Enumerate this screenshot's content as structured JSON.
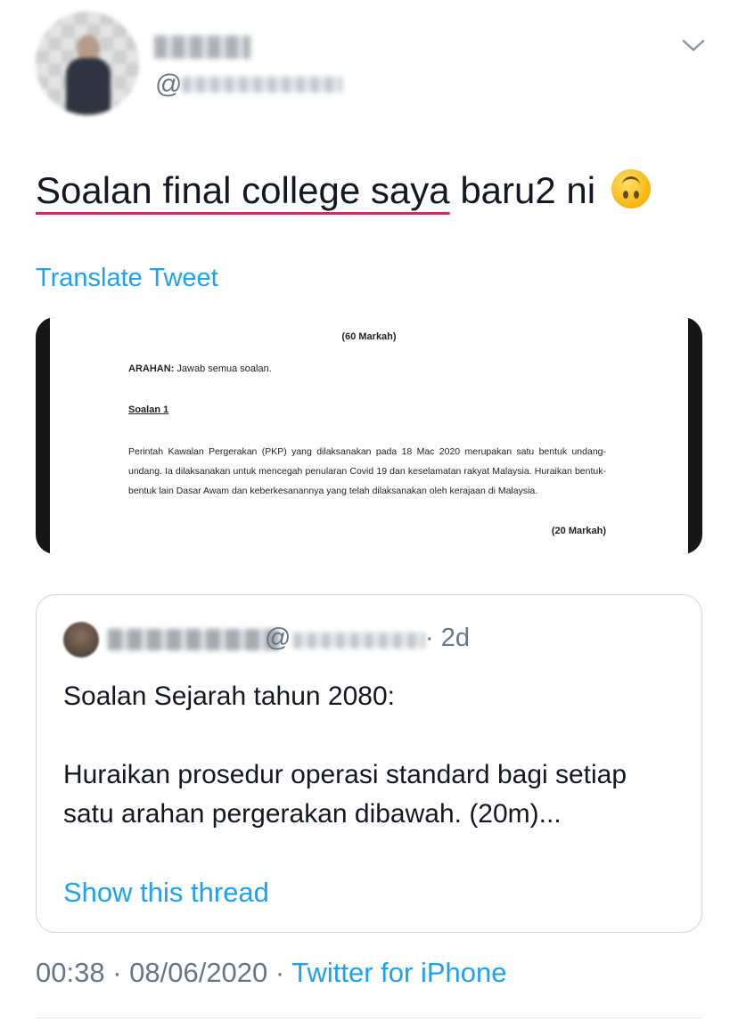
{
  "tweet": {
    "handle_prefix": "@",
    "text_underlined": "Soalan final college saya",
    "text_rest": " baru2 ni",
    "emoji": "upside-down-face",
    "translate_label": "Translate Tweet"
  },
  "media": {
    "marks_top": "(60 Markah)",
    "arahan_label": "ARAHAN:",
    "arahan_text": " Jawab semua soalan.",
    "soalan_heading": "Soalan 1",
    "paragraph": "Perintah Kawalan Pergerakan (PKP) yang dilaksanakan pada 18 Mac 2020 merupakan satu bentuk undang-undang. Ia dilaksanakan untuk mencegah penularan Covid 19 dan keselamatan rakyat Malaysia. Huraikan bentuk-bentuk lain Dasar Awam dan keberkesanannya yang telah dilaksanakan oleh kerajaan di Malaysia.",
    "marks_bottom": "(20 Markah)"
  },
  "quoted": {
    "handle_prefix": "@",
    "time": "· 2d",
    "line1": "Soalan Sejarah tahun 2080:",
    "line2": "Huraikan prosedur operasi standard bagi setiap satu arahan pergerakan dibawah. (20m)...",
    "show_thread": "Show this thread"
  },
  "meta": {
    "time": "00:38 · 08/06/2020 · ",
    "source": "Twitter for iPhone"
  },
  "colors": {
    "link": "#1da1f2",
    "secondary": "#657786",
    "underline": "#e0245e"
  }
}
